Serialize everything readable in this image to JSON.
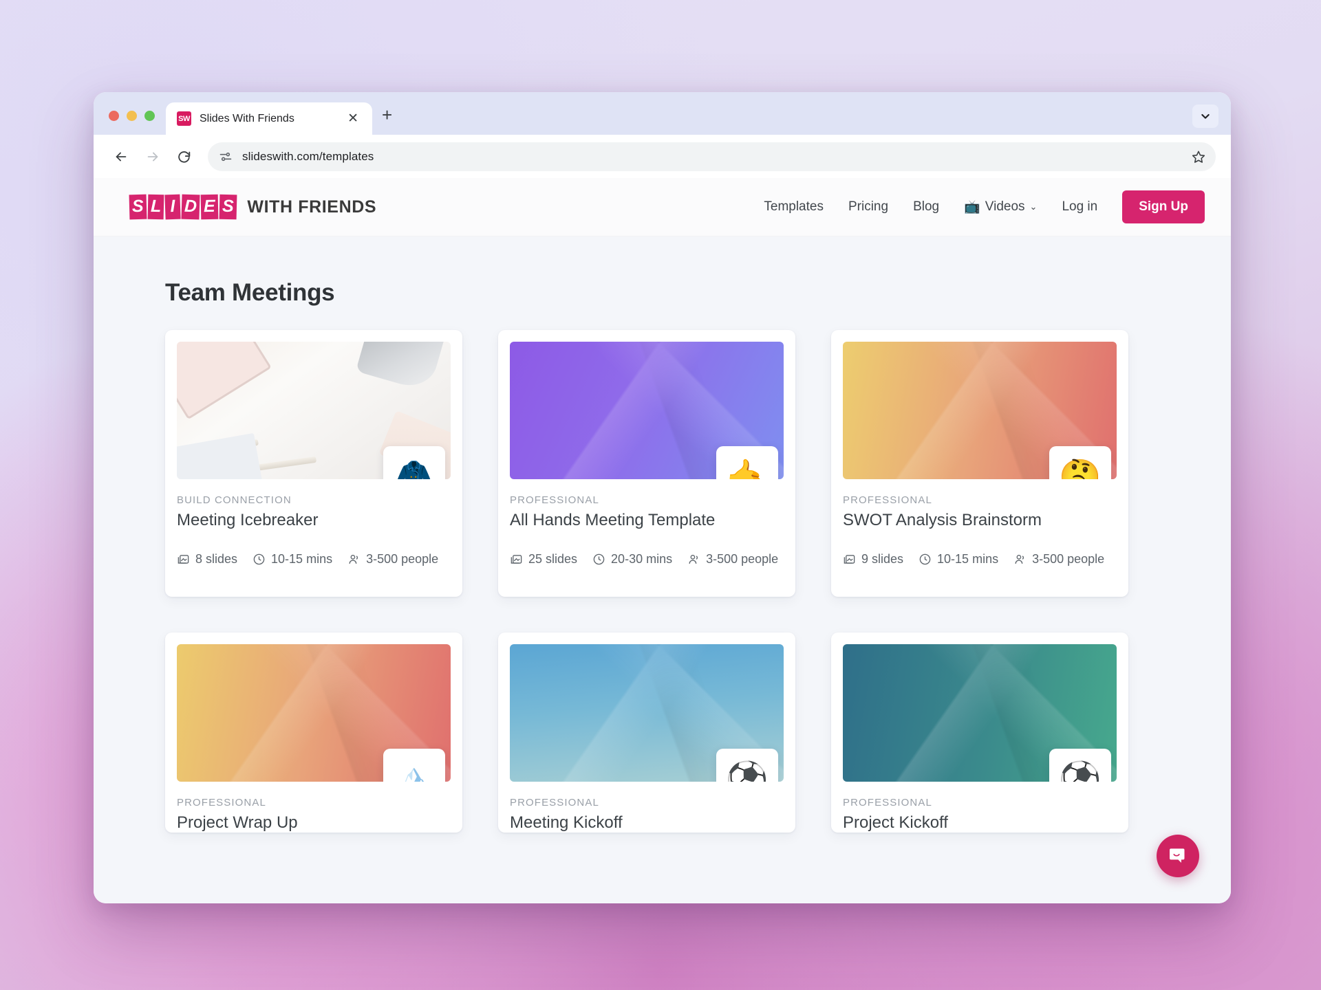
{
  "browser": {
    "tab": {
      "title": "Slides With Friends",
      "favicon_label": "SW",
      "close_label": "✕"
    },
    "new_tab_label": "+",
    "url": "slideswith.com/templates",
    "back_label": "←",
    "forward_label": "→",
    "reload_label": "⟳"
  },
  "site": {
    "logo": {
      "boxed_letters": [
        "S",
        "L",
        "I",
        "D",
        "E",
        "S"
      ],
      "rest": "WITH FRIENDS"
    },
    "nav": [
      {
        "label": "Templates",
        "icon": ""
      },
      {
        "label": "Pricing",
        "icon": ""
      },
      {
        "label": "Blog",
        "icon": ""
      },
      {
        "label": "Videos",
        "icon": "📺",
        "chevron": "⌄"
      },
      {
        "label": "Log in",
        "icon": ""
      }
    ],
    "signup_label": "Sign Up",
    "accent_color": "#d6246e"
  },
  "page": {
    "title": "Team Meetings",
    "cards": [
      {
        "category": "BUILD CONNECTION",
        "title": "Meeting Icebreaker",
        "emoji": "🧥",
        "slides": "8 slides",
        "duration": "10-15 mins",
        "people": "3-500 people",
        "thumb_kind": "photo"
      },
      {
        "category": "PROFESSIONAL",
        "title": "All Hands Meeting Template",
        "emoji": "🤙",
        "slides": "25 slides",
        "duration": "20-30 mins",
        "people": "3-500 people",
        "thumb_kind": "gradient",
        "thumb_from": "#8d5ae6",
        "thumb_to": "#7f8ff0"
      },
      {
        "category": "PROFESSIONAL",
        "title": "SWOT Analysis Brainstorm",
        "emoji": "🤔",
        "slides": "9 slides",
        "duration": "10-15 mins",
        "people": "3-500 people",
        "thumb_kind": "gradient",
        "thumb_from": "#edcd6f",
        "thumb_to": "#e0706e"
      },
      {
        "category": "PROFESSIONAL",
        "title": "Project Wrap Up",
        "emoji": "🏔️",
        "slides": "",
        "duration": "",
        "people": "",
        "thumb_kind": "gradient",
        "thumb_from": "#eccb6d",
        "thumb_to": "#e0706e"
      },
      {
        "category": "PROFESSIONAL",
        "title": "Meeting Kickoff",
        "emoji": "⚽",
        "slides": "",
        "duration": "",
        "people": "",
        "thumb_kind": "gradient",
        "thumb_from": "#5ba6d4",
        "thumb_to": "#a7cfd4"
      },
      {
        "category": "PROFESSIONAL",
        "title": "Project Kickoff",
        "emoji": "⚽",
        "slides": "",
        "duration": "",
        "people": "",
        "thumb_kind": "gradient",
        "thumb_from": "#2f6f8a",
        "thumb_to": "#47a98d"
      }
    ]
  },
  "widget": {
    "chat_color": "#cf2361"
  }
}
